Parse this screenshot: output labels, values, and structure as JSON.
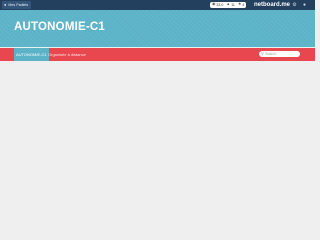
{
  "topbar": {
    "mes_button_label": "Mes Padlets",
    "stats": {
      "views": "33.0",
      "likes": "11",
      "stars": "4"
    },
    "brand": "netboard.me",
    "icons": [
      "user-icon",
      "eye-icon",
      "thumbs-up-icon",
      "star-icon",
      "settings-icon",
      "account-icon"
    ]
  },
  "header": {
    "title": "AUTONOMIE-C1",
    "background_color": "#5cb3c8"
  },
  "nav": {
    "background_color": "#e8474f",
    "tabs": [
      {
        "label": "AUTONOMIE-C1",
        "active": true
      },
      {
        "label": "Organisée à distance",
        "active": false
      }
    ],
    "search_placeholder": "Search"
  }
}
